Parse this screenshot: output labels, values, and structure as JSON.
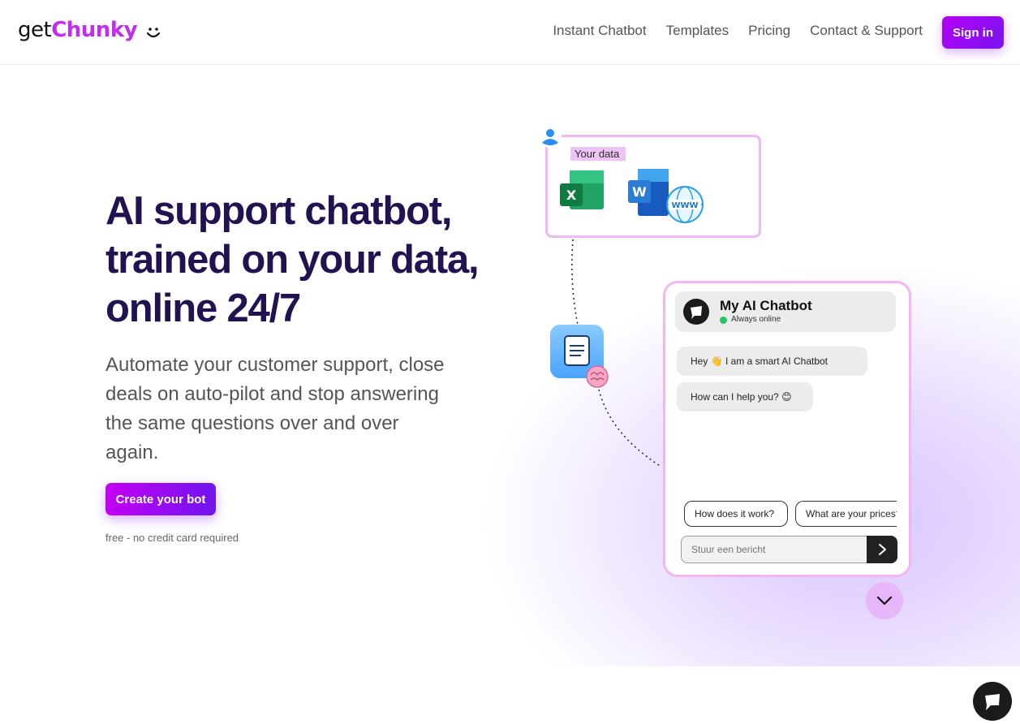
{
  "header": {
    "logo_get": "get",
    "logo_chunky": "Chunky",
    "nav": [
      "Instant Chatbot",
      "Templates",
      "Pricing",
      "Contact & Support"
    ],
    "signin_label": "Sign in"
  },
  "hero": {
    "title_lines": [
      "AI support chatbot,",
      "trained on your data,",
      "online 24/7"
    ],
    "subtitle": "Automate your customer support, close deals on auto-pilot and stop answering the same questions over and over again.",
    "cta_label": "Create your bot",
    "cta_note": "free - no credit card required"
  },
  "data_card": {
    "tag": "Your data",
    "icons": [
      "excel-icon",
      "word-icon",
      "www-globe-icon"
    ]
  },
  "chat": {
    "name": "My AI Chatbot",
    "status": "Always online",
    "messages": [
      "Hey 👋 I am a smart AI Chatbot",
      "How can I help you? 😊"
    ],
    "suggestions": [
      "How does it work?",
      "What are your prices?"
    ],
    "input_placeholder": "Stuur een bericht"
  },
  "colors": {
    "brand_purple": "#c12cf0",
    "title_navy": "#221251",
    "online_green": "#22c55e"
  }
}
